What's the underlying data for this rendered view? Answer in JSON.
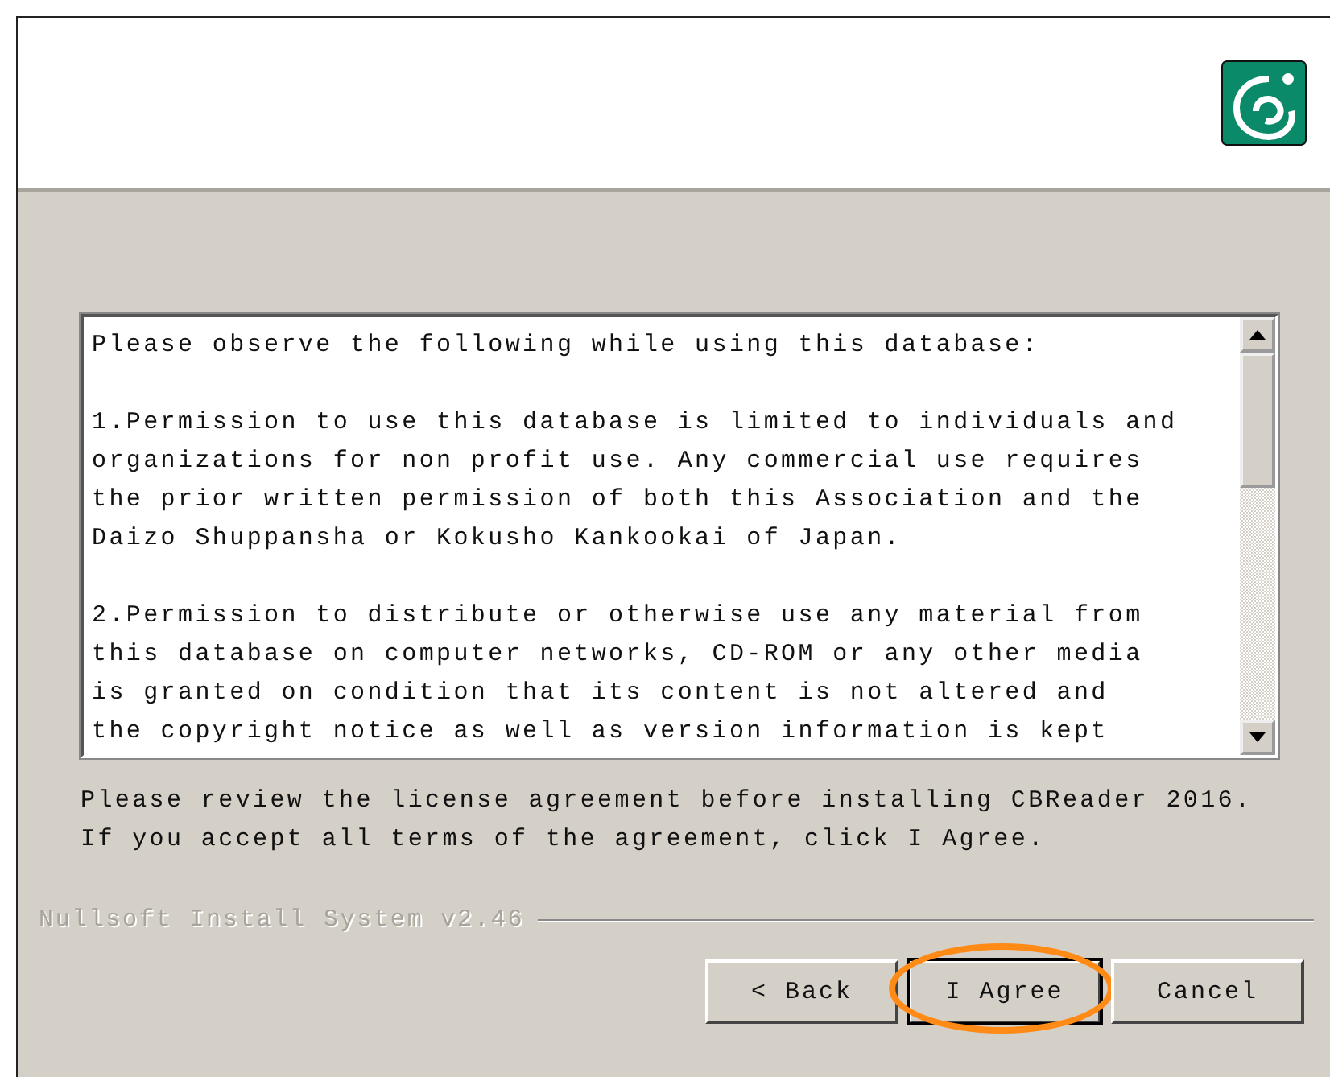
{
  "license": {
    "paragraphs": [
      [
        "Please observe the following while using this database:"
      ],
      [
        "1.Permission to use this database is limited to individuals and",
        "organizations for non profit use. Any commercial use requires",
        "the prior written permission of both this Association and the",
        "Daizo Shuppansha or Kokusho Kankookai of Japan."
      ],
      [
        "2.Permission to distribute or otherwise use any material from",
        "this database on computer networks, CD-ROM or any other media",
        "is granted on condition that its content is not altered and",
        "the copyright notice as well as version information is kept"
      ]
    ]
  },
  "instructions": [
    "Please review the license agreement before installing CBReader 2016.",
    "If you accept all terms of the agreement, click I Agree."
  ],
  "branding": "Nullsoft Install System v2.46",
  "buttons": [
    {
      "label": "< Back",
      "default": false,
      "highlighted": false
    },
    {
      "label": "I Agree",
      "default": true,
      "highlighted": true
    },
    {
      "label": "Cancel",
      "default": false,
      "highlighted": false
    }
  ]
}
